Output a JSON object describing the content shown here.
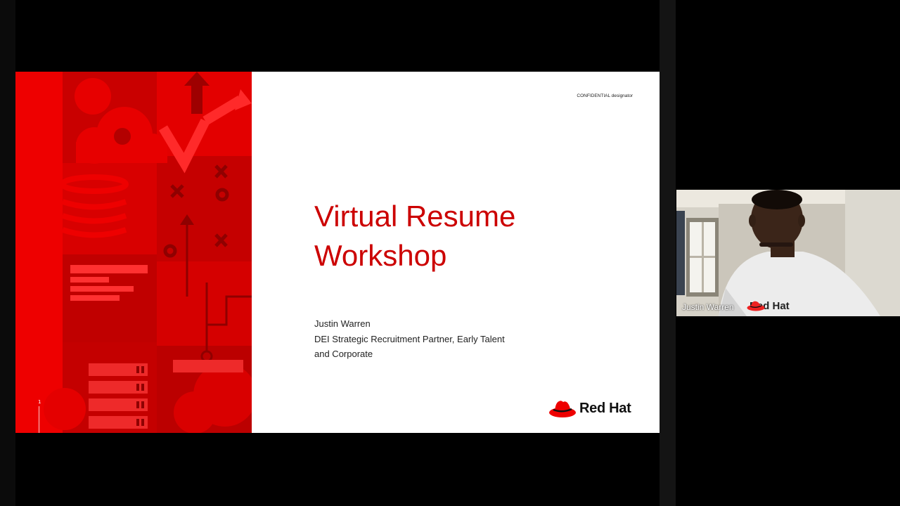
{
  "slide": {
    "confidential_label": "CONFIDENTIAL designator",
    "title_line1": "Virtual Resume",
    "title_line2": "Workshop",
    "presenter_name": "Justin Warren",
    "presenter_role_line1": "DEI Strategic Recruitment Partner, Early Talent",
    "presenter_role_line2": "and Corporate",
    "page_number": "1",
    "brand_label": "Red Hat"
  },
  "video": {
    "participant_name": "Justin Warren",
    "shirt_logo_text": "Red Hat"
  },
  "colors": {
    "brand_red": "#ee0000",
    "title_red": "#cc0000",
    "background": "#000000"
  },
  "icons": [
    "red-hat-logo-icon",
    "cloud-icon",
    "database-icon",
    "server-rack-icon",
    "arrow-up-icon"
  ]
}
